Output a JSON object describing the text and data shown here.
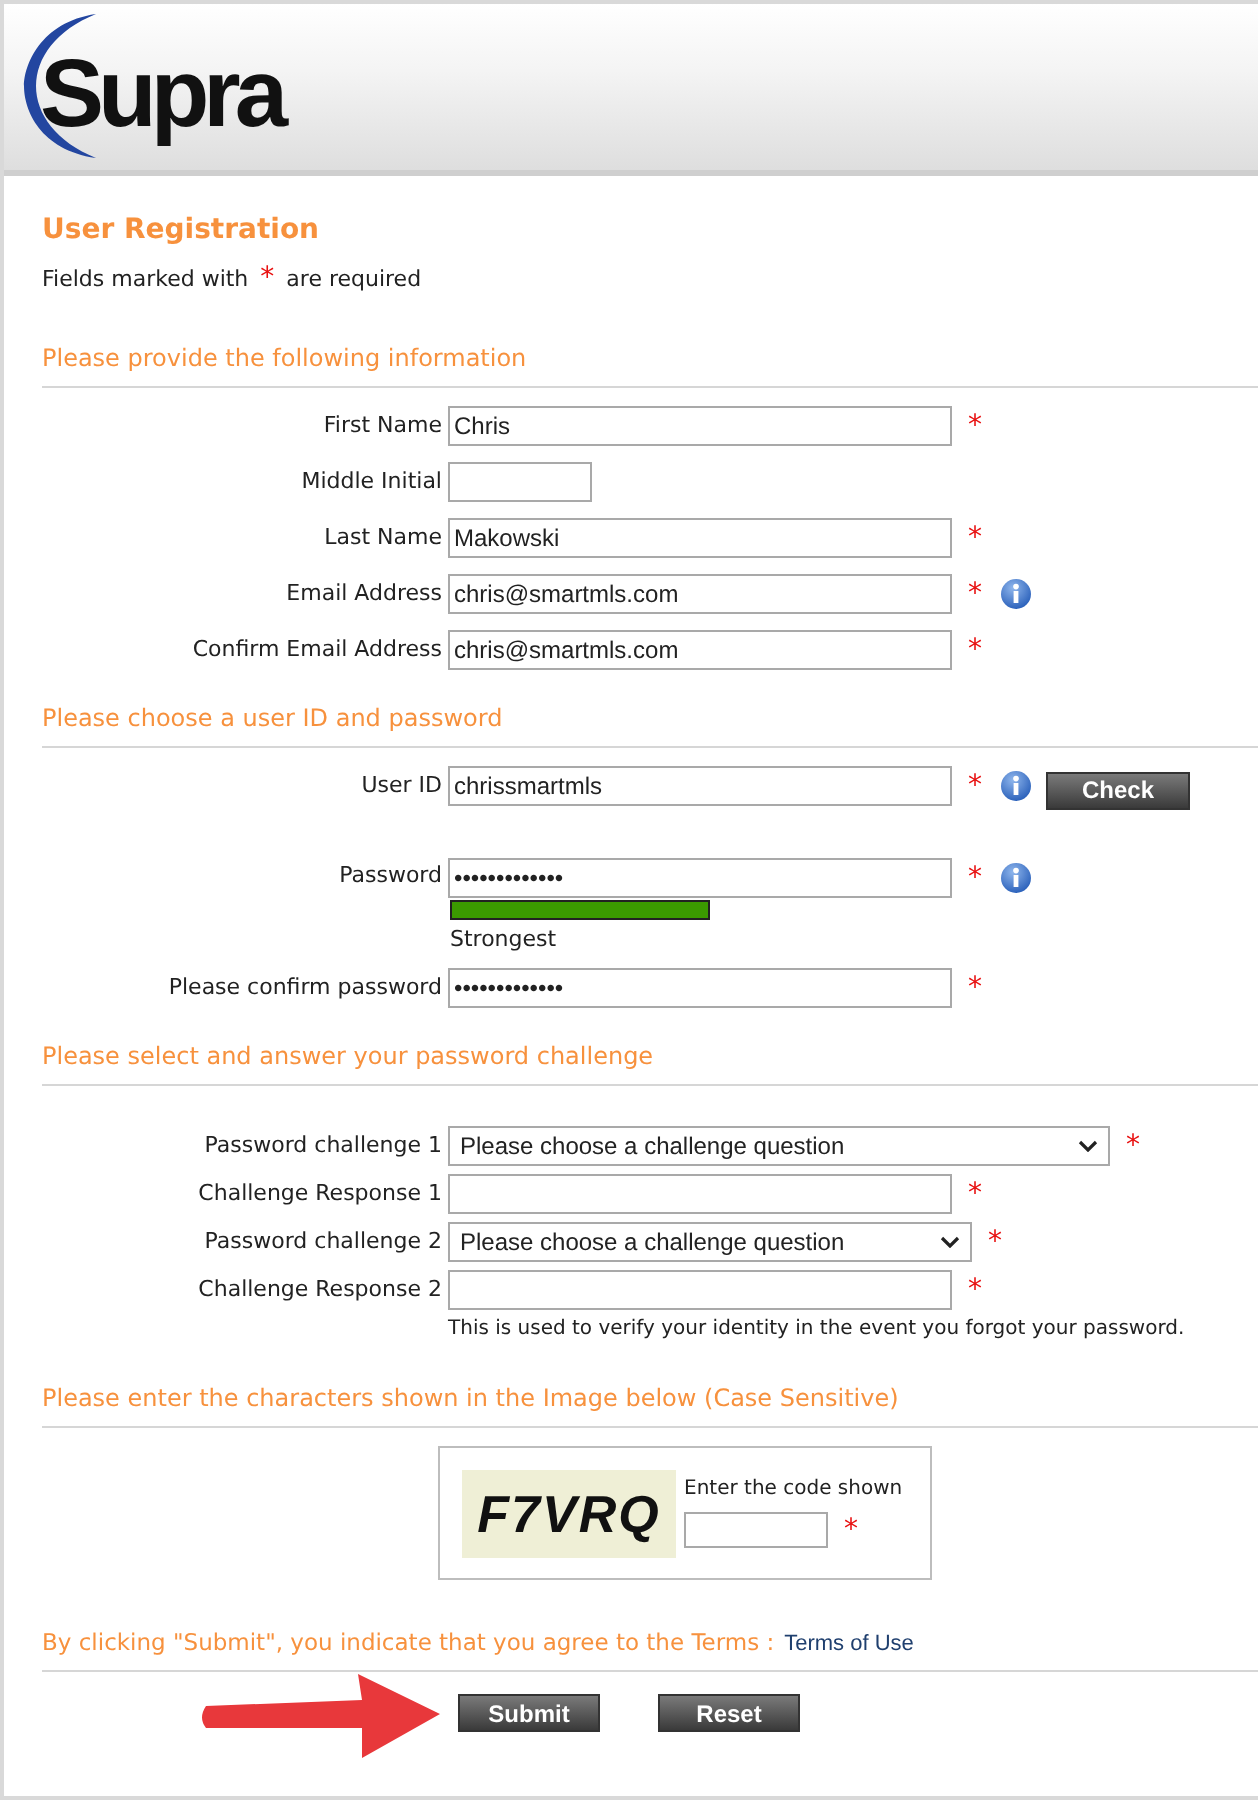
{
  "header": {
    "logo": "Supra"
  },
  "title": "User Registration",
  "required_note": {
    "before": "Fields marked with",
    "marker": "*",
    "after": "are required"
  },
  "sections": [
    {
      "heading": "Please provide the following information",
      "fields": [
        {
          "kind": "text",
          "label": "First Name",
          "value": "Chris",
          "required": true,
          "info": false
        },
        {
          "kind": "initial",
          "label": "Middle Initial",
          "required": false,
          "info": false
        },
        {
          "kind": "text",
          "label": "Last Name",
          "value": "Makowski",
          "required": true,
          "info": false
        },
        {
          "kind": "text",
          "label": "Email Address",
          "value": "chris@smartmls.com",
          "required": true,
          "info": true
        },
        {
          "kind": "text",
          "label": "Confirm Email Address",
          "value": "chris@smartmls.com",
          "required": true,
          "info": false
        }
      ]
    },
    {
      "heading": "Please choose a user ID and password",
      "fields": [
        {
          "kind": "text",
          "label": "User ID",
          "value": "chrissmartmls",
          "required": true,
          "info": true,
          "button": "Check"
        },
        {
          "kind": "password",
          "label": "Password",
          "value": "•••••••••••••",
          "required": true,
          "info": true,
          "strength": {
            "level": 1,
            "label": "Strongest"
          }
        },
        {
          "kind": "text",
          "label": "Please confirm password",
          "value": "•••••••••••••",
          "required": true,
          "info": false
        }
      ]
    },
    {
      "heading": "Please select and answer your password challenge",
      "fields": [
        {
          "kind": "select",
          "label": "Password challenge 1",
          "value": "Please choose a challenge question",
          "required": true,
          "info": false
        },
        {
          "kind": "text",
          "label": "Challenge Response 1",
          "required": true,
          "info": false
        },
        {
          "kind": "select",
          "label": "Password challenge 2",
          "value": "Please choose a challenge question",
          "required": true,
          "info": false
        },
        {
          "kind": "text",
          "label": "Challenge Response 2",
          "required": true,
          "info": false
        },
        {
          "kind": "note",
          "text": "This is used to verify your identity in the event you forgot your password."
        }
      ]
    },
    {
      "heading": "Please enter the characters shown in the Image below (Case Sensitive)",
      "captcha": {
        "code": "F7VRQ",
        "prompt": "Enter the code shown",
        "required": true
      }
    }
  ],
  "terms": {
    "text": "By clicking \"Submit\", you indicate that you agree to the Terms :",
    "link": "Terms of Use"
  },
  "buttons": [
    "Submit",
    "Reset"
  ]
}
